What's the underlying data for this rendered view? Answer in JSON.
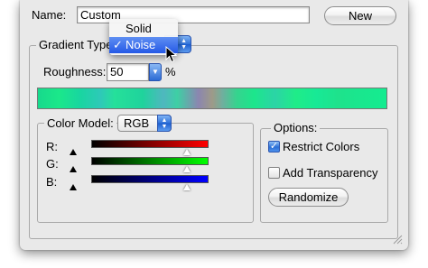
{
  "name_field": {
    "label": "Name:",
    "value": "Custom"
  },
  "new_button": {
    "label": "New"
  },
  "gradient_type": {
    "label": "Gradient Type:",
    "menu_items": [
      {
        "label": "Solid",
        "checked": false
      },
      {
        "label": "Noise",
        "checked": true
      }
    ],
    "check_glyph": "✓"
  },
  "roughness": {
    "label": "Roughness:",
    "value": "50",
    "unit": "%"
  },
  "color_model": {
    "label": "Color Model:",
    "selected": "RGB",
    "channels": [
      {
        "label": "R:",
        "color": "#ff0000"
      },
      {
        "label": "G:",
        "color": "#00ff00"
      },
      {
        "label": "B:",
        "color": "#0000ff"
      }
    ]
  },
  "options": {
    "title": "Options:",
    "restrict_colors": {
      "label": "Restrict Colors",
      "checked": true
    },
    "add_transparency": {
      "label": "Add Transparency",
      "checked": false
    },
    "randomize_label": "Randomize"
  },
  "colors": {
    "dialog_bg": "#e9e9e9",
    "accent": "#2458e6"
  },
  "icons": {
    "cursor": "arrow-cursor-icon",
    "popup_arrows": "updown-arrows-icon",
    "resize": "resize-grip-icon"
  }
}
